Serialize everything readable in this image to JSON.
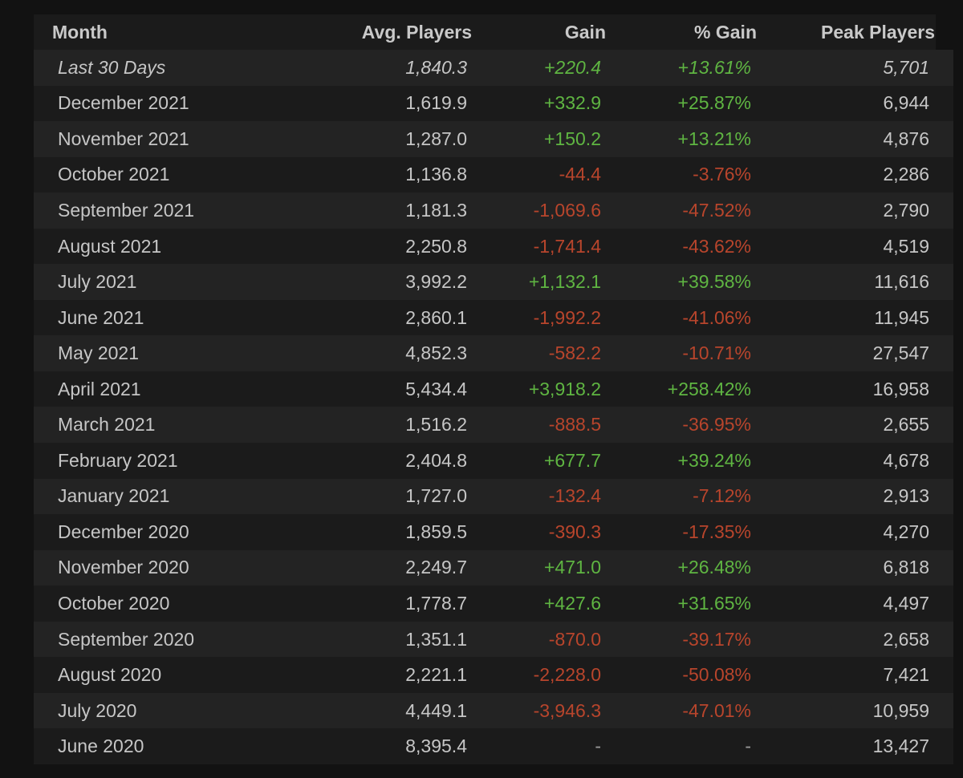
{
  "headers": {
    "month": "Month",
    "avg": "Avg. Players",
    "gain": "Gain",
    "pct": "% Gain",
    "peak": "Peak Players"
  },
  "rows": [
    {
      "month": "Last 30 Days",
      "avg": "1,840.3",
      "gain": "+220.4",
      "pct": "+13.61%",
      "peak": "5,701",
      "trend": "pos",
      "italic": true
    },
    {
      "month": "December 2021",
      "avg": "1,619.9",
      "gain": "+332.9",
      "pct": "+25.87%",
      "peak": "6,944",
      "trend": "pos"
    },
    {
      "month": "November 2021",
      "avg": "1,287.0",
      "gain": "+150.2",
      "pct": "+13.21%",
      "peak": "4,876",
      "trend": "pos"
    },
    {
      "month": "October 2021",
      "avg": "1,136.8",
      "gain": "-44.4",
      "pct": "-3.76%",
      "peak": "2,286",
      "trend": "neg"
    },
    {
      "month": "September 2021",
      "avg": "1,181.3",
      "gain": "-1,069.6",
      "pct": "-47.52%",
      "peak": "2,790",
      "trend": "neg"
    },
    {
      "month": "August 2021",
      "avg": "2,250.8",
      "gain": "-1,741.4",
      "pct": "-43.62%",
      "peak": "4,519",
      "trend": "neg"
    },
    {
      "month": "July 2021",
      "avg": "3,992.2",
      "gain": "+1,132.1",
      "pct": "+39.58%",
      "peak": "11,616",
      "trend": "pos"
    },
    {
      "month": "June 2021",
      "avg": "2,860.1",
      "gain": "-1,992.2",
      "pct": "-41.06%",
      "peak": "11,945",
      "trend": "neg"
    },
    {
      "month": "May 2021",
      "avg": "4,852.3",
      "gain": "-582.2",
      "pct": "-10.71%",
      "peak": "27,547",
      "trend": "neg"
    },
    {
      "month": "April 2021",
      "avg": "5,434.4",
      "gain": "+3,918.2",
      "pct": "+258.42%",
      "peak": "16,958",
      "trend": "pos"
    },
    {
      "month": "March 2021",
      "avg": "1,516.2",
      "gain": "-888.5",
      "pct": "-36.95%",
      "peak": "2,655",
      "trend": "neg"
    },
    {
      "month": "February 2021",
      "avg": "2,404.8",
      "gain": "+677.7",
      "pct": "+39.24%",
      "peak": "4,678",
      "trend": "pos"
    },
    {
      "month": "January 2021",
      "avg": "1,727.0",
      "gain": "-132.4",
      "pct": "-7.12%",
      "peak": "2,913",
      "trend": "neg"
    },
    {
      "month": "December 2020",
      "avg": "1,859.5",
      "gain": "-390.3",
      "pct": "-17.35%",
      "peak": "4,270",
      "trend": "neg"
    },
    {
      "month": "November 2020",
      "avg": "2,249.7",
      "gain": "+471.0",
      "pct": "+26.48%",
      "peak": "6,818",
      "trend": "pos"
    },
    {
      "month": "October 2020",
      "avg": "1,778.7",
      "gain": "+427.6",
      "pct": "+31.65%",
      "peak": "4,497",
      "trend": "pos"
    },
    {
      "month": "September 2020",
      "avg": "1,351.1",
      "gain": "-870.0",
      "pct": "-39.17%",
      "peak": "2,658",
      "trend": "neg"
    },
    {
      "month": "August 2020",
      "avg": "2,221.1",
      "gain": "-2,228.0",
      "pct": "-50.08%",
      "peak": "7,421",
      "trend": "neg"
    },
    {
      "month": "July 2020",
      "avg": "4,449.1",
      "gain": "-3,946.3",
      "pct": "-47.01%",
      "peak": "10,959",
      "trend": "neg"
    },
    {
      "month": "June 2020",
      "avg": "8,395.4",
      "gain": "-",
      "pct": "-",
      "peak": "13,427",
      "trend": "neutral"
    }
  ],
  "colors": {
    "positive": "#5fb542",
    "negative": "#b8452c",
    "background": "#1b1b1b",
    "row_alt": "#232323"
  }
}
